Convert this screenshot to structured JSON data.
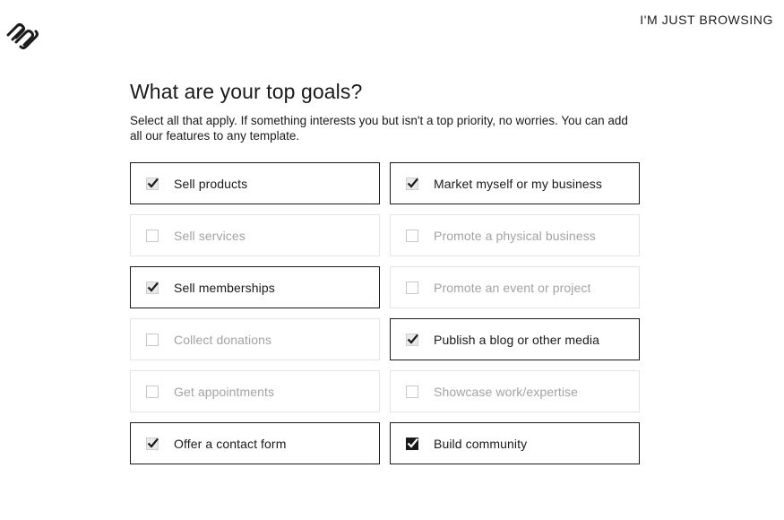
{
  "header": {
    "logo_icon": "squarespace-logo-icon",
    "browse_label": "I'M JUST BROWSING"
  },
  "main": {
    "title": "What are your top goals?",
    "subtitle": "Select all that apply. If something interests you but isn't a top priority, no worries. You can add all our features to any template."
  },
  "options": [
    {
      "label": "Sell products",
      "checked": true
    },
    {
      "label": "Market myself or my business",
      "checked": true
    },
    {
      "label": "Sell services",
      "checked": false
    },
    {
      "label": "Promote a physical business",
      "checked": false
    },
    {
      "label": "Sell memberships",
      "checked": true
    },
    {
      "label": "Promote an event or project",
      "checked": false
    },
    {
      "label": "Collect donations",
      "checked": false
    },
    {
      "label": "Publish a blog or other media",
      "checked": true
    },
    {
      "label": "Get appointments",
      "checked": false
    },
    {
      "label": "Showcase work/expertise",
      "checked": false
    },
    {
      "label": "Offer a contact form",
      "checked": true
    },
    {
      "label": "Build community",
      "checked": true
    }
  ],
  "colors": {
    "text": "#1a1a1a",
    "muted_text": "#a3a3a3",
    "unchecked_border": "#e4e4e4",
    "checked_border": "#1a1a1a"
  }
}
